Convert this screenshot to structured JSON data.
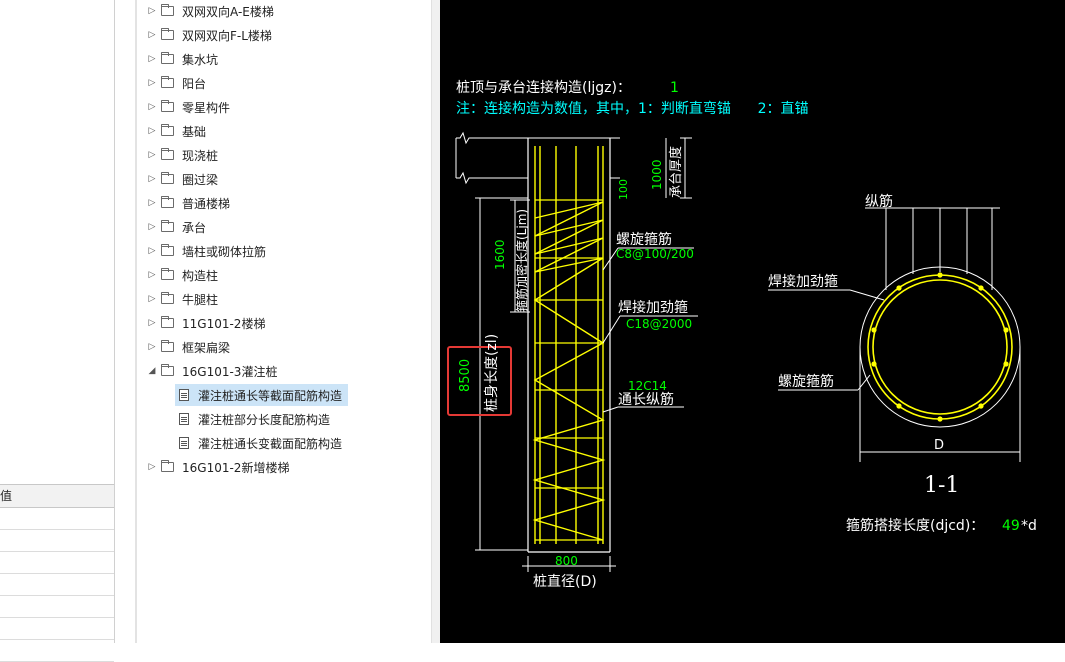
{
  "tree": {
    "items": [
      {
        "label": "双网双向A-E楼梯",
        "type": "folder",
        "level": 0
      },
      {
        "label": "双网双向F-L楼梯",
        "type": "folder",
        "level": 0
      },
      {
        "label": "集水坑",
        "type": "folder",
        "level": 0
      },
      {
        "label": "阳台",
        "type": "folder",
        "level": 0
      },
      {
        "label": "零星构件",
        "type": "folder",
        "level": 0
      },
      {
        "label": "基础",
        "type": "folder",
        "level": 0
      },
      {
        "label": "现浇桩",
        "type": "folder",
        "level": 0
      },
      {
        "label": "圈过梁",
        "type": "folder",
        "level": 0
      },
      {
        "label": "普通楼梯",
        "type": "folder",
        "level": 0
      },
      {
        "label": "承台",
        "type": "folder",
        "level": 0
      },
      {
        "label": "墙柱或砌体拉筋",
        "type": "folder",
        "level": 0
      },
      {
        "label": "构造柱",
        "type": "folder",
        "level": 0
      },
      {
        "label": "牛腿柱",
        "type": "folder",
        "level": 0
      },
      {
        "label": "11G101-2楼梯",
        "type": "folder",
        "level": 0
      },
      {
        "label": "框架扁梁",
        "type": "folder",
        "level": 0
      },
      {
        "label": "16G101-3灌注桩",
        "type": "folder-open",
        "level": 0
      },
      {
        "label": "灌注桩通长等截面配筋构造",
        "type": "doc",
        "level": 1,
        "selected": true
      },
      {
        "label": "灌注桩部分长度配筋构造",
        "type": "doc",
        "level": 1
      },
      {
        "label": "灌注桩通长变截面配筋构造",
        "type": "doc",
        "level": 1
      },
      {
        "label": "16G101-2新增楼梯",
        "type": "folder",
        "level": 0
      }
    ]
  },
  "prop_table": {
    "header": "值"
  },
  "drawing": {
    "connection_label": "桩顶与承台连接构造(ljgz)：",
    "connection_value": "1",
    "note": "注：连接构造为数值，其中，1：判断直弯锚      2：直锚",
    "cap_thickness_value": "1000",
    "cap_thickness_label": "承台厚度",
    "top_offset": "100",
    "dense_length_value": "1600",
    "dense_length_label": "箍筋加密长度(Ljm)",
    "spiral_label": "螺旋箍筋",
    "spiral_spec": "C8@100/200",
    "stiff_label": "焊接加劲箍",
    "stiff_spec": "C18@2000",
    "long_spec": "12C14",
    "long_label": "通长纵筋",
    "pile_length_value": "8500",
    "pile_length_label": "桩身长度(zl)",
    "diameter_value": "800",
    "diameter_label": "桩直径(D)",
    "section_long_label": "纵筋",
    "section_stiff_label": "焊接加劲箍",
    "section_spiral_label": "螺旋箍筋",
    "section_d": "D",
    "section_title": "1-1",
    "lap_label": "箍筋搭接长度(djcd)：",
    "lap_value": "49",
    "lap_suffix": "*d",
    "colors": {
      "bg": "#000000",
      "white": "#ffffff",
      "yellow": "#ffff00",
      "green": "#00ff00",
      "cyan": "#00ffff",
      "red": "#e53935"
    }
  }
}
